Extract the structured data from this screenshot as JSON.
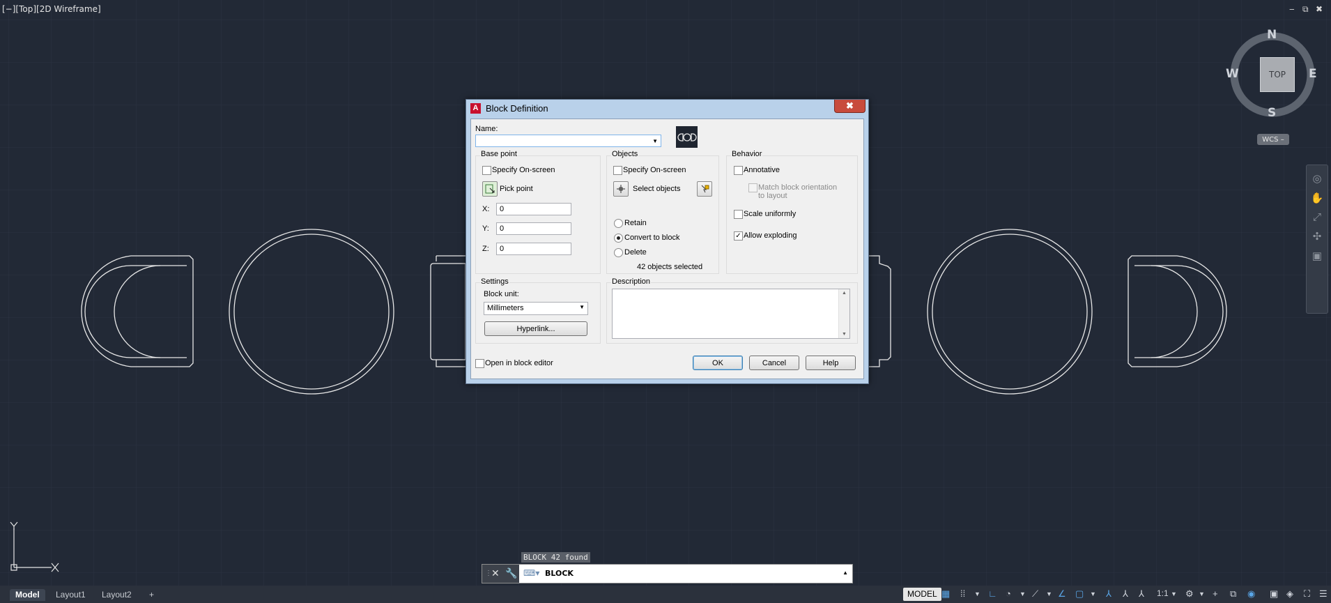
{
  "viewport": {
    "label": "[−][Top][2D Wireframe]",
    "controls": [
      "‒",
      "⧉",
      "✖"
    ]
  },
  "viewcube": {
    "north": "N",
    "south": "S",
    "east": "E",
    "west": "W",
    "face": "TOP",
    "wcs": "WCS –"
  },
  "ucs": {
    "x": "X",
    "y": "Y"
  },
  "dialog": {
    "title": "Block Definition",
    "close": "✖",
    "name_label": "Name:",
    "name_value": "",
    "base_point": {
      "title": "Base point",
      "specify_onscreen": "Specify On-screen",
      "pick_point": "Pick point",
      "x_label": "X:",
      "x_value": "0",
      "y_label": "Y:",
      "y_value": "0",
      "z_label": "Z:",
      "z_value": "0"
    },
    "objects": {
      "title": "Objects",
      "specify_onscreen": "Specify On-screen",
      "select_objects": "Select objects",
      "retain": "Retain",
      "convert": "Convert to block",
      "delete": "Delete",
      "count": "42 objects selected"
    },
    "behavior": {
      "title": "Behavior",
      "annotative": "Annotative",
      "match_orientation": "Match block orientation",
      "match_orientation_2": "to layout",
      "scale_uniformly": "Scale uniformly",
      "allow_exploding": "Allow exploding"
    },
    "settings": {
      "title": "Settings",
      "block_unit_label": "Block unit:",
      "block_unit_value": "Millimeters",
      "hyperlink": "Hyperlink..."
    },
    "description": {
      "title": "Description"
    },
    "open_in_editor": "Open in block editor",
    "ok": "OK",
    "cancel": "Cancel",
    "help": "Help"
  },
  "command": {
    "hint": "BLOCK 42 found",
    "text": "BLOCK"
  },
  "tabs": [
    "Model",
    "Layout1",
    "Layout2",
    "+"
  ],
  "status": {
    "model": "MODEL",
    "scale": "1:1"
  }
}
